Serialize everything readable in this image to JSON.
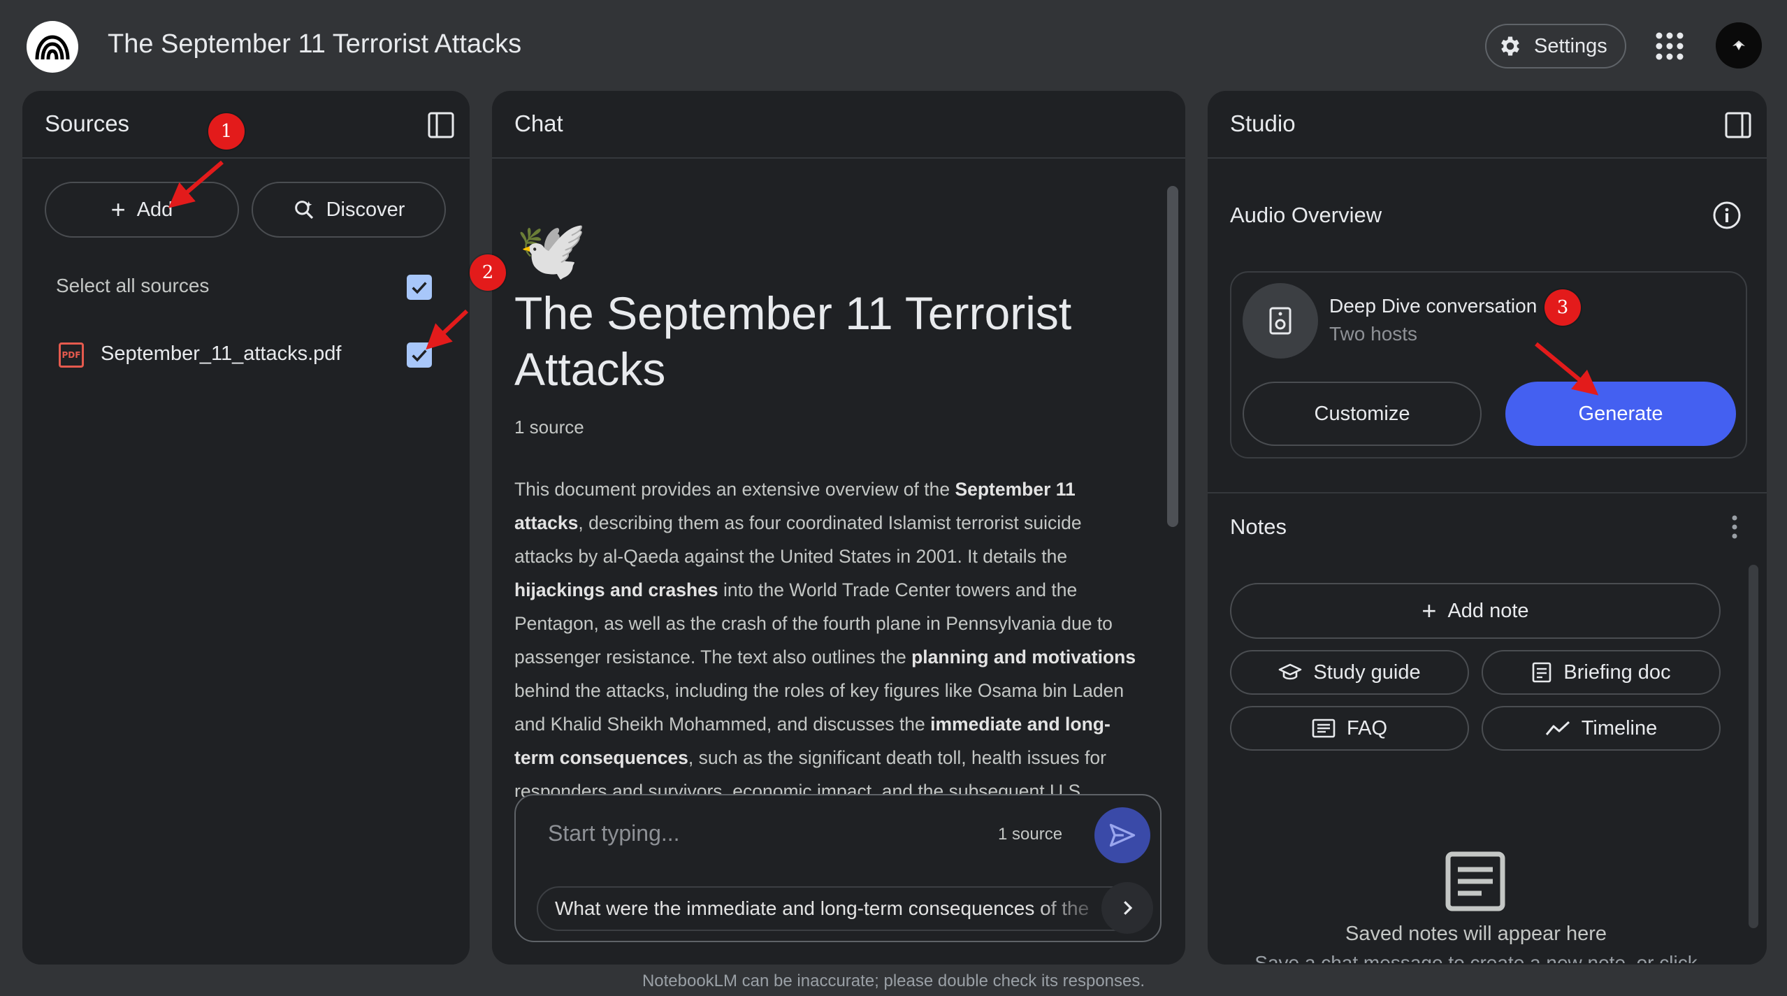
{
  "header": {
    "title": "The September 11 Terrorist Attacks",
    "settings_label": "Settings",
    "icons": {
      "logo": "notebooklm-logo-icon",
      "settings": "gear-icon",
      "apps": "apps-grid-icon",
      "avatar": "user-avatar"
    }
  },
  "sources_panel": {
    "title": "Sources",
    "add_label": "Add",
    "discover_label": "Discover",
    "select_all_label": "Select all sources",
    "select_all_checked": true,
    "items": [
      {
        "name": "September_11_attacks.pdf",
        "type_icon": "pdf-icon",
        "type_label": "PDF",
        "checked": true
      }
    ]
  },
  "chat_panel": {
    "title": "Chat",
    "emoji": "🕊️",
    "notebook_title": "The September 11 Terrorist Attacks",
    "source_count": "1 source",
    "summary": [
      {
        "t": "This document provides an extensive overview of the "
      },
      {
        "t": "September 11 attacks",
        "b": true
      },
      {
        "t": ", describing them as four coordinated Islamist terrorist suicide attacks by al-Qaeda against the United States in 2001. It details the "
      },
      {
        "t": "hijackings and crashes",
        "b": true
      },
      {
        "t": " into the World Trade Center towers and the Pentagon, as well as the crash of the fourth plane in Pennsylvania due to passenger resistance. The text also outlines the "
      },
      {
        "t": "planning and motivations",
        "b": true
      },
      {
        "t": " behind the attacks, including the roles of key figures like Osama bin Laden and Khalid Sheikh Mohammed, and discusses the "
      },
      {
        "t": "immediate and long-term consequences",
        "b": true
      },
      {
        "t": ", such as the significant death toll, health issues for responders and survivors, economic impact, and the subsequent U.S. responses like the global war on terror."
      }
    ],
    "input_placeholder": "Start typing...",
    "input_source_count": "1 source",
    "suggestion": "What were the immediate and long-term consequences of the"
  },
  "studio_panel": {
    "title": "Studio",
    "audio_overview": {
      "heading": "Audio Overview",
      "card_title": "Deep Dive conversation",
      "card_subtitle": "Two hosts",
      "customize_label": "Customize",
      "generate_label": "Generate"
    },
    "notes": {
      "heading": "Notes",
      "add_note_label": "Add note",
      "buttons": [
        {
          "label": "Study guide",
          "icon": "graduation-cap-icon"
        },
        {
          "label": "Briefing doc",
          "icon": "document-list-icon"
        },
        {
          "label": "FAQ",
          "icon": "faq-list-icon"
        },
        {
          "label": "Timeline",
          "icon": "trend-line-icon"
        }
      ],
      "empty_title": "Saved notes will appear here",
      "empty_subtitle": "Save a chat message to create a new note, or click"
    }
  },
  "annotations": {
    "badge_1": "1",
    "badge_2": "2",
    "badge_3": "3",
    "color": "#e31b1b"
  },
  "footer": "NotebookLM can be inaccurate; please double check its responses.",
  "colors": {
    "background": "#323437",
    "panel": "#1f2124",
    "accent": "#4460f1",
    "checkbox": "#a8c7fa"
  }
}
